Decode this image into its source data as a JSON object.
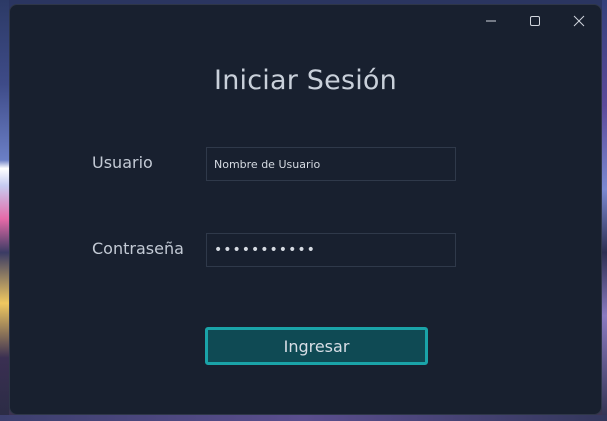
{
  "window": {
    "controls": {
      "minimize_icon": "minimize-icon",
      "maximize_icon": "maximize-icon",
      "close_icon": "close-icon"
    }
  },
  "login": {
    "title": "Iniciar Sesión",
    "username_label": "Usuario",
    "username_value": "Nombre de Usuario",
    "password_label": "Contraseña",
    "password_value": "•••••••••••",
    "submit_label": "Ingresar"
  },
  "colors": {
    "window_background": "#18202f",
    "button_background": "#0f4a54",
    "button_border": "#1aa3a8",
    "text": "#c9d0da"
  }
}
